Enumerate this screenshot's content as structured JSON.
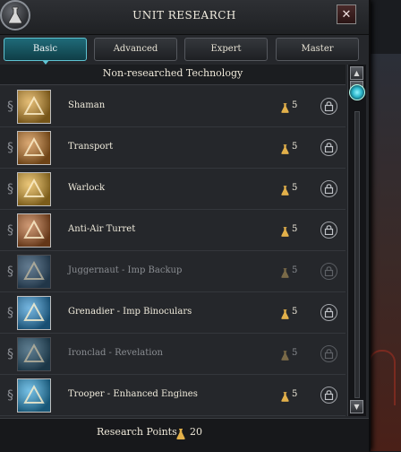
{
  "window": {
    "title": "UNIT RESEARCH",
    "close_glyph": "✕"
  },
  "tabs": [
    {
      "label": "Basic",
      "active": true
    },
    {
      "label": "Advanced",
      "active": false
    },
    {
      "label": "Expert",
      "active": false
    },
    {
      "label": "Master",
      "active": false
    }
  ],
  "section": {
    "title": "Non-researched Technology"
  },
  "technologies": [
    {
      "name": "Shaman",
      "cost": "5",
      "available": true,
      "icon": "shaman-icon",
      "color": "#d69a2c"
    },
    {
      "name": "Transport",
      "cost": "5",
      "available": true,
      "icon": "transport-icon",
      "color": "#c77a28"
    },
    {
      "name": "Warlock",
      "cost": "5",
      "available": true,
      "icon": "warlock-icon",
      "color": "#e0a830"
    },
    {
      "name": "Anti-Air Turret",
      "cost": "5",
      "available": true,
      "icon": "anti-air-turret-icon",
      "color": "#b5622a"
    },
    {
      "name": "Juggernaut - Imp Backup",
      "cost": "5",
      "available": false,
      "icon": "juggernaut-upgrade-icon",
      "color": "#3a6e9a"
    },
    {
      "name": "Grenadier - Imp Binoculars",
      "cost": "5",
      "available": true,
      "icon": "grenadier-upgrade-icon",
      "color": "#2b8fd0"
    },
    {
      "name": "Ironclad - Revelation",
      "cost": "5",
      "available": false,
      "icon": "ironclad-upgrade-icon",
      "color": "#2c6f96"
    },
    {
      "name": "Trooper - Enhanced Engines",
      "cost": "5",
      "available": true,
      "icon": "trooper-upgrade-icon",
      "color": "#2b9ed8"
    }
  ],
  "footer": {
    "label": "Research Points",
    "value": "20"
  },
  "icons": {
    "cost": "research-flask-icon",
    "lock": "lock-icon",
    "title": "research-emblem-icon"
  },
  "colors": {
    "accent": "#5fc3d2",
    "active_tab": "#1f6a78"
  }
}
